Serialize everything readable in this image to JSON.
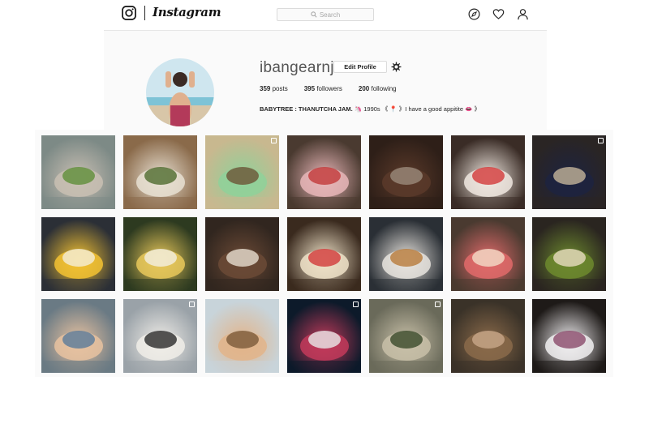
{
  "nav": {
    "brand": "Instagram",
    "search_placeholder": "Search",
    "icons": [
      "instagram-camera-icon",
      "explore-compass-icon",
      "activity-heart-icon",
      "profile-person-icon"
    ]
  },
  "profile": {
    "username": "ibangearnj",
    "edit_label": "Edit Profile",
    "stats": {
      "posts_count": "359",
      "posts_label": "posts",
      "followers_count": "395",
      "followers_label": "followers",
      "following_count": "200",
      "following_label": "following"
    },
    "bio_name": "BABYTREE : THANUTCHA JAM.",
    "bio_text": "🦄 1990s 《 📍 》I have a good appitite 👄 》"
  },
  "posts": [
    {
      "subject": "street vendor with green produce",
      "colors": [
        "#7d8a86",
        "#c9bfb3",
        "#5f8f3a"
      ],
      "multi": false
    },
    {
      "subject": "coffee pour and plant",
      "colors": [
        "#8a6a4a",
        "#e8e0d2",
        "#4f6b2e"
      ],
      "multi": false
    },
    {
      "subject": "green matcha dessert",
      "colors": [
        "#c8b88f",
        "#8fd19a",
        "#6d5436"
      ],
      "multi": true
    },
    {
      "subject": "strawberry tart",
      "colors": [
        "#4a3a30",
        "#e8b6b8",
        "#c23a3a"
      ],
      "multi": false
    },
    {
      "subject": "chocolate cake",
      "colors": [
        "#2e1f18",
        "#5b3a2a",
        "#9a8a7a"
      ],
      "multi": false
    },
    {
      "subject": "strawberry cake",
      "colors": [
        "#3a2c26",
        "#f0e8e0",
        "#d33a3a"
      ],
      "multi": false
    },
    {
      "subject": "berry tart",
      "colors": [
        "#2a2524",
        "#1d2340",
        "#c4b49a"
      ],
      "multi": true
    },
    {
      "subject": "mango cheesecake",
      "colors": [
        "#2b2f36",
        "#f3c232",
        "#f4eed8"
      ],
      "multi": false
    },
    {
      "subject": "fruit tart",
      "colors": [
        "#2d3a20",
        "#e8c85a",
        "#f2efe2"
      ],
      "multi": false
    },
    {
      "subject": "chocolate cream cake",
      "colors": [
        "#31261f",
        "#6b4a36",
        "#e6ddd0"
      ],
      "multi": false
    },
    {
      "subject": "strawberry cheesecake",
      "colors": [
        "#3a2a1e",
        "#efe2c8",
        "#d23a3a"
      ],
      "multi": false
    },
    {
      "subject": "plate of pasta",
      "colors": [
        "#2a2f35",
        "#e8e4de",
        "#b87a3a"
      ],
      "multi": false
    },
    {
      "subject": "red berry tart",
      "colors": [
        "#4a3a30",
        "#e06a6a",
        "#f2dcc8"
      ],
      "multi": false
    },
    {
      "subject": "matcha tart",
      "colors": [
        "#2a2520",
        "#6d8a2e",
        "#e8dcc0"
      ],
      "multi": false
    },
    {
      "subject": "smiling child",
      "colors": [
        "#6a7a84",
        "#e8c2a0",
        "#5a7a9a"
      ],
      "multi": false
    },
    {
      "subject": "white cat and car",
      "colors": [
        "#9aa2a8",
        "#f0ede8",
        "#2a2a2a"
      ],
      "multi": true
    },
    {
      "subject": "father and child",
      "colors": [
        "#c8d4da",
        "#e2b48a",
        "#7a5a3a"
      ],
      "multi": false
    },
    {
      "subject": "night fireworks",
      "colors": [
        "#0d1a2a",
        "#c23a5a",
        "#e8e8e8"
      ],
      "multi": true
    },
    {
      "subject": "dried flowers",
      "colors": [
        "#6a6a5a",
        "#c8c0a8",
        "#3a4a2a"
      ],
      "multi": true
    },
    {
      "subject": "cafe interior",
      "colors": [
        "#3a3228",
        "#8a6a4a",
        "#c8a88a"
      ],
      "multi": false
    },
    {
      "subject": "ice cream sundae",
      "colors": [
        "#1e1a18",
        "#f0eef0",
        "#8a4a6a"
      ],
      "multi": false
    }
  ]
}
